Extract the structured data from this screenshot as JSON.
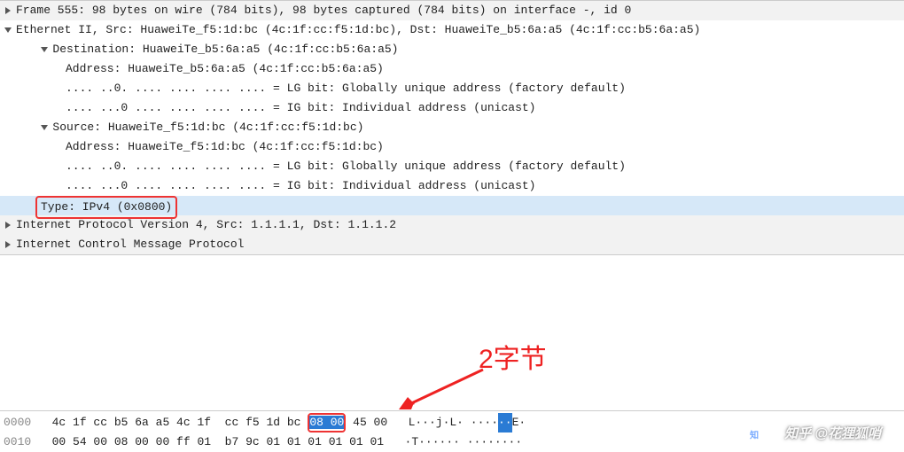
{
  "tree": {
    "frame": "Frame 555: 98 bytes on wire (784 bits), 98 bytes captured (784 bits) on interface -, id 0",
    "eth": "Ethernet II, Src: HuaweiTe_f5:1d:bc (4c:1f:cc:f5:1d:bc), Dst: HuaweiTe_b5:6a:a5 (4c:1f:cc:b5:6a:a5)",
    "dst": "Destination: HuaweiTe_b5:6a:a5 (4c:1f:cc:b5:6a:a5)",
    "dst_addr": "Address: HuaweiTe_b5:6a:a5 (4c:1f:cc:b5:6a:a5)",
    "dst_lg": ".... ..0. .... .... .... .... = LG bit: Globally unique address (factory default)",
    "dst_ig": ".... ...0 .... .... .... .... = IG bit: Individual address (unicast)",
    "src": "Source: HuaweiTe_f5:1d:bc (4c:1f:cc:f5:1d:bc)",
    "src_addr": "Address: HuaweiTe_f5:1d:bc (4c:1f:cc:f5:1d:bc)",
    "src_lg": ".... ..0. .... .... .... .... = LG bit: Globally unique address (factory default)",
    "src_ig": ".... ...0 .... .... .... .... = IG bit: Individual address (unicast)",
    "type": "Type: IPv4 (0x0800)",
    "ipv4": "Internet Protocol Version 4, Src: 1.1.1.1, Dst: 1.1.1.2",
    "icmp": "Internet Control Message Protocol"
  },
  "hex": {
    "row0_off": "0000",
    "row0_a": "4c 1f cc b5 6a a5 4c 1f",
    "row0_b1": "cc f5 1d bc",
    "row0_sel": "08 00",
    "row0_b2": "45 00",
    "row0_ascii_a": "L···j·L·",
    "row0_ascii_b": " ····",
    "row0_ascii_sel": "··",
    "row0_ascii_c": "E·",
    "row1_off": "0010",
    "row1_a": "00 54 00 08 00 00 ff 01",
    "row1_b": "b7 9c 01 01 01 01 01 01",
    "row1_ascii": "·T······ ········"
  },
  "annotation": {
    "label": "2字节"
  },
  "watermark": {
    "text": "知乎 @花狸狐哨"
  }
}
